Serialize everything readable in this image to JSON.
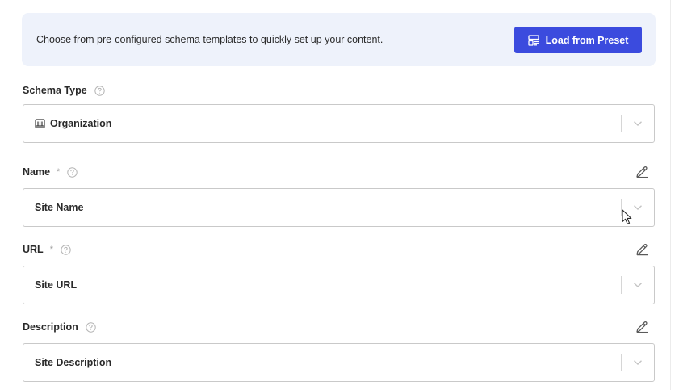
{
  "banner": {
    "text": "Choose from pre-configured schema templates to quickly set up your content.",
    "button_label": "Load from Preset",
    "button_icon": "layout-template-icon"
  },
  "fields": {
    "schema_type": {
      "label": "Schema Type",
      "required": false,
      "value": "Organization",
      "value_icon": "building-icon"
    },
    "name": {
      "label": "Name",
      "required": true,
      "required_mark": "*",
      "value": "Site Name"
    },
    "url": {
      "label": "URL",
      "required": true,
      "required_mark": "*",
      "value": "Site URL"
    },
    "description": {
      "label": "Description",
      "required": false,
      "value": "Site Description"
    }
  },
  "colors": {
    "accent": "#3b4bde",
    "banner_bg": "#eef2fb",
    "border": "#c9c9c9"
  }
}
